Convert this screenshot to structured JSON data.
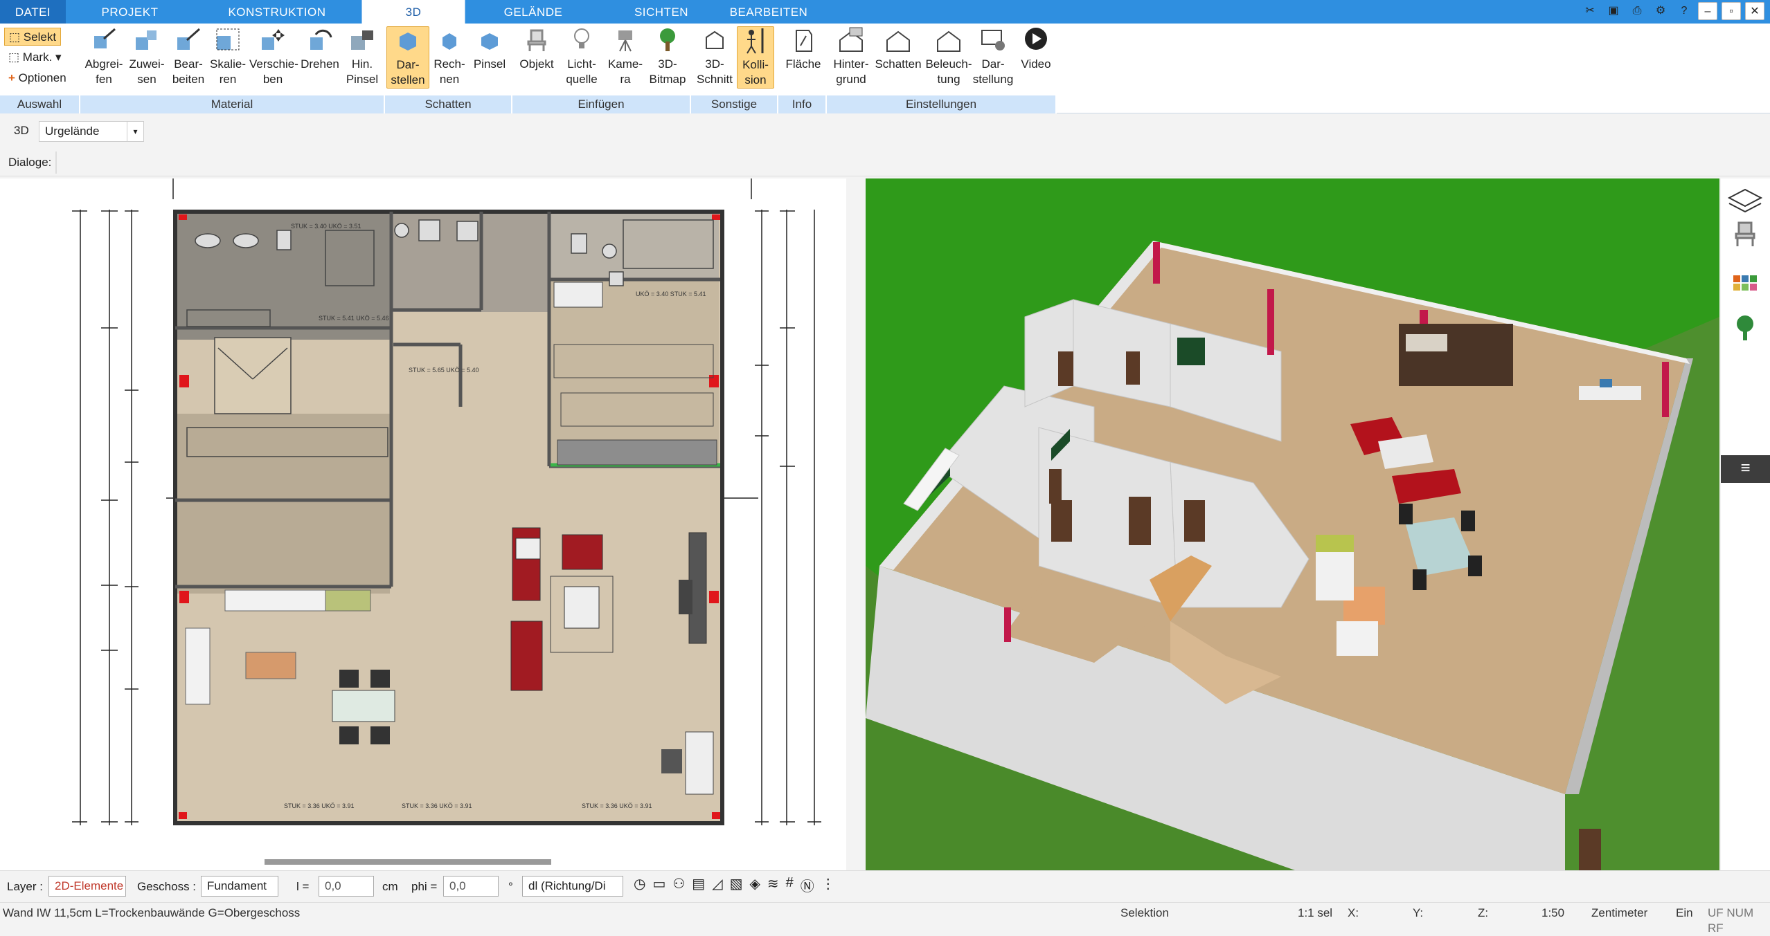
{
  "tabs": [
    "DATEI",
    "PROJEKT",
    "KONSTRUKTION",
    "3D",
    "GELÄNDE",
    "SICHTEN",
    "BEARBEITEN"
  ],
  "selection": {
    "selekt": "Selekt",
    "mark": "Mark.",
    "optionen": "Optionen"
  },
  "ribbon_buttons": {
    "abgreifen": "Abgrei-\nfen",
    "zuweisen": "Zuwei-\nsen",
    "bearbeiten": "Bear-\nbeiten",
    "skalieren": "Skalie-\nren",
    "verschieben": "Verschie-\nben",
    "drehen": "Drehen",
    "hinpinsel": "Hin.\nPinsel",
    "darstellen": "Dar-\nstellen",
    "rechnen": "Rech-\nnen",
    "pinsel": "Pinsel",
    "objekt": "Objekt",
    "lichtquelle": "Licht-\nquelle",
    "kamera": "Kame-\nra",
    "bitmap3d": "3D-\nBitmap",
    "schnitt3d": "3D-\nSchnitt",
    "kollision": "Kolli-\nsion",
    "flaeche": "Fläche",
    "hintergrund": "Hinter-\ngrund",
    "schatten": "Schatten",
    "beleuchtung": "Beleuch-\ntung",
    "darstellung": "Dar-\nstellung",
    "video": "Video"
  },
  "groups": [
    "Auswahl",
    "Material",
    "Schatten",
    "Einfügen",
    "Sonstige",
    "Info",
    "Einstellungen"
  ],
  "subbar": {
    "mode": "3D",
    "terrain": "Urgelände"
  },
  "dialoge_label": "Dialoge:",
  "plan_labels": [
    "STUK = 3.40\nUKÖ = 3.51",
    "STUK = 5.41\nUKÖ = 5.46",
    "STUK = 5.65\nUKÖ = 5.40",
    "UKÖ = 3.40\nSTUK = 5.41",
    "STUK = 3.36\nUKÖ = 3.91"
  ],
  "bottom": {
    "layer_label": "Layer :",
    "layer_value": "2D-Elemente",
    "geschoss_label": "Geschoss :",
    "geschoss_value": "Fundament",
    "l_label": "l =",
    "l_value": "0,0",
    "l_unit": "cm",
    "phi_label": "phi =",
    "phi_value": "0,0",
    "phi_unit": "°",
    "direction_value": "dl (Richtung/Di"
  },
  "status": {
    "left": "Wand IW 11,5cm L=Trockenbauwände G=Obergeschoss",
    "mode": "Selektion",
    "sel": "1:1 sel",
    "x": "X:",
    "y": "Y:",
    "z": "Z:",
    "scale": "1:50",
    "unit": "Zentimeter",
    "ein": "Ein",
    "flags": "UF NUM RF"
  },
  "colors": {
    "accent": "#2f8fe0",
    "grass": "#2f9a1a",
    "floor": "#cdb99a",
    "wall": "#e9e9e9",
    "sofa": "#b3121c"
  }
}
